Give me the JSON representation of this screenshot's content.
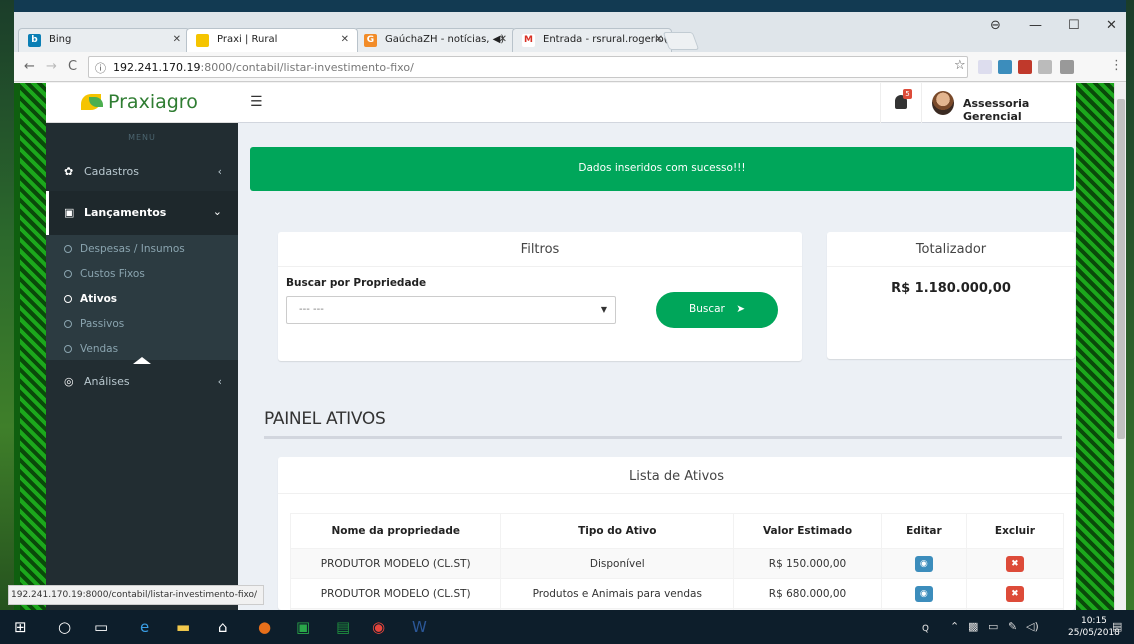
{
  "browser": {
    "tabs": [
      {
        "label": "Bing",
        "icon": "b"
      },
      {
        "label": "Praxi | Rural",
        "icon": "leaf"
      },
      {
        "label": "GaúchaZH - notícias, ◀)",
        "icon": "gzh"
      },
      {
        "label": "Entrada - rsrural.rogerio(",
        "icon": "M"
      }
    ],
    "url_host": "192.241.170.19",
    "url_path": ":8000/contabil/listar-investimento-fixo/",
    "status_url": "192.241.170.19:8000/contabil/listar-investimento-fixo/",
    "accent": "#00a65a"
  },
  "app": {
    "logo": "Praxiagro",
    "menu_header": "MENU",
    "sidebar": {
      "cadastros": "Cadastros",
      "lancamentos": "Lançamentos",
      "sub": [
        "Despesas / Insumos",
        "Custos Fixos",
        "Ativos",
        "Passivos",
        "Vendas"
      ],
      "analises": "Análises"
    },
    "notification_count": "5",
    "user": "Assessoria Gerencial",
    "alert": "Dados inseridos com sucesso!!!",
    "filtros": {
      "title": "Filtros",
      "label": "Buscar por Propriedade",
      "select_value": "--- ---",
      "button": "Buscar"
    },
    "totalizador": {
      "title": "Totalizador",
      "value": "R$ 1.180.000,00"
    },
    "painel_title": "PAINEL ATIVOS",
    "lista": {
      "title": "Lista de Ativos",
      "headers": [
        "Nome da propriedade",
        "Tipo do Ativo",
        "Valor Estimado",
        "Editar",
        "Excluir"
      ],
      "rows": [
        {
          "nome": "PRODUTOR MODELO (CL.ST)",
          "tipo": "Disponível",
          "valor": "R$ 150.000,00"
        },
        {
          "nome": "PRODUTOR MODELO (CL.ST)",
          "tipo": "Produtos e Animais para vendas",
          "valor": "R$ 680.000,00"
        }
      ]
    }
  },
  "taskbar": {
    "time": "10:15",
    "date": "25/05/2018"
  }
}
